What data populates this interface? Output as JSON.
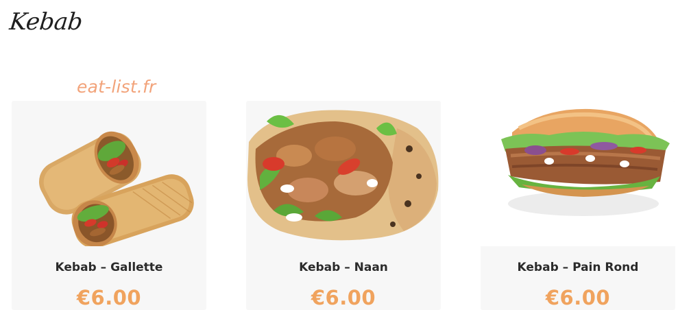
{
  "section": {
    "title": "Kebab"
  },
  "watermark": {
    "text": "eat-list.fr"
  },
  "products": [
    {
      "name": "Kebab – Gallette",
      "price": "€6.00",
      "image": "wrap-gallette-image"
    },
    {
      "name": "Kebab – Naan",
      "price": "€6.00",
      "image": "naan-kebab-image"
    },
    {
      "name": "Kebab – Pain Rond",
      "price": "€6.00",
      "image": "pain-rond-kebab-image"
    }
  ],
  "colors": {
    "price": "#f0a35e",
    "watermark": "#f2a37a",
    "card_background": "#f7f7f7",
    "title": "#1f1f1f"
  }
}
